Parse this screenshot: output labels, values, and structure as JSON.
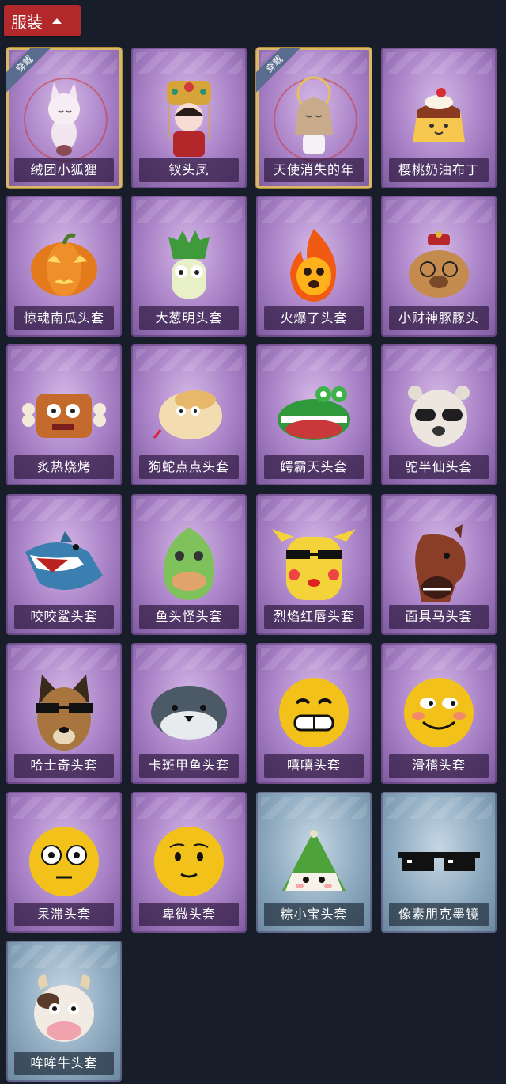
{
  "section": {
    "title": "服装"
  },
  "badge_text": "穿戴",
  "items": [
    {
      "name": "绒团小狐狸",
      "equipped": true,
      "theme": "purple",
      "icon": "fox-icon"
    },
    {
      "name": "钗头凤",
      "equipped": false,
      "theme": "purple",
      "icon": "phoenix-crown-icon"
    },
    {
      "name": "天使消失的年",
      "equipped": true,
      "theme": "purple",
      "icon": "angel-girl-icon"
    },
    {
      "name": "樱桃奶油布丁",
      "equipped": false,
      "theme": "purple",
      "icon": "pudding-icon"
    },
    {
      "name": "惊魂南瓜头套",
      "equipped": false,
      "theme": "purple",
      "icon": "pumpkin-icon"
    },
    {
      "name": "大葱明头套",
      "equipped": false,
      "theme": "purple",
      "icon": "scallion-icon"
    },
    {
      "name": "火爆了头套",
      "equipped": false,
      "theme": "purple",
      "icon": "fire-icon"
    },
    {
      "name": "小财神豚豚头",
      "equipped": false,
      "theme": "purple",
      "icon": "capybara-icon"
    },
    {
      "name": "炙热烧烤",
      "equipped": false,
      "theme": "purple",
      "icon": "bbq-icon"
    },
    {
      "name": "狗蛇点点头套",
      "equipped": false,
      "theme": "purple",
      "icon": "snake-icon"
    },
    {
      "name": "鳄霸天头套",
      "equipped": false,
      "theme": "purple",
      "icon": "crocodile-icon"
    },
    {
      "name": "驼半仙头套",
      "equipped": false,
      "theme": "purple",
      "icon": "alpaca-icon"
    },
    {
      "name": "咬咬鲨头套",
      "equipped": false,
      "theme": "purple",
      "icon": "shark-icon"
    },
    {
      "name": "鱼头怪头套",
      "equipped": false,
      "theme": "purple",
      "icon": "fish-head-icon"
    },
    {
      "name": "烈焰红唇头套",
      "equipped": false,
      "theme": "purple",
      "icon": "pikachu-icon"
    },
    {
      "name": "面具马头套",
      "equipped": false,
      "theme": "purple",
      "icon": "horse-icon"
    },
    {
      "name": "哈士奇头套",
      "equipped": false,
      "theme": "purple",
      "icon": "husky-icon"
    },
    {
      "name": "卡斑甲鱼头套",
      "equipped": false,
      "theme": "purple",
      "icon": "seal-icon"
    },
    {
      "name": "嘻嘻头套",
      "equipped": false,
      "theme": "purple",
      "icon": "grin-emoji-icon"
    },
    {
      "name": "滑稽头套",
      "equipped": false,
      "theme": "purple",
      "icon": "funny-emoji-icon"
    },
    {
      "name": "呆滞头套",
      "equipped": false,
      "theme": "purple",
      "icon": "dazed-emoji-icon"
    },
    {
      "name": "卑微头套",
      "equipped": false,
      "theme": "purple",
      "icon": "humble-emoji-icon"
    },
    {
      "name": "粽小宝头套",
      "equipped": false,
      "theme": "blue",
      "icon": "zongzi-icon"
    },
    {
      "name": "像素朋克墨镜",
      "equipped": false,
      "theme": "blue",
      "icon": "pixel-glasses-icon"
    },
    {
      "name": "哞哞牛头套",
      "equipped": false,
      "theme": "blue",
      "icon": "cow-icon"
    }
  ],
  "colors": {
    "background": "#171d29",
    "header_red": "#b3292b",
    "card_purple": "#a880c6",
    "card_blue": "#8eaac0",
    "equipped_gold": "#d9b866"
  }
}
